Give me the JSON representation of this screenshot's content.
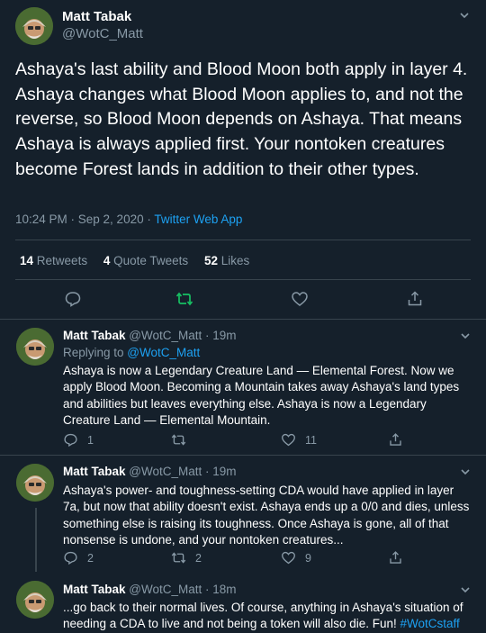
{
  "main": {
    "author": {
      "name": "Matt Tabak",
      "handle": "@WotC_Matt"
    },
    "text": "Ashaya's last ability and Blood Moon both apply in layer 4. Ashaya changes what Blood Moon applies to, and not the reverse, so Blood Moon depends on Ashaya. That means Ashaya is always applied first. Your nontoken creatures become Forest lands in addition to their other types.",
    "time": "10:24 PM · Sep 2, 2020 · ",
    "source": "Twitter Web App",
    "stats": {
      "retweets_count": "14",
      "retweets_label": "Retweets",
      "quotes_count": "4",
      "quotes_label": "Quote Tweets",
      "likes_count": "52",
      "likes_label": "Likes"
    },
    "icons": [
      "reply-icon",
      "retweet-icon",
      "like-icon",
      "share-icon"
    ],
    "retweet_color": "#17bf63"
  },
  "replies": [
    {
      "name": "Matt Tabak",
      "handle": "@WotC_Matt",
      "age": " · 19m",
      "replying_label": "Replying to ",
      "replying_to": "@WotC_Matt",
      "text": "Ashaya is now a Legendary Creature Land — Elemental Forest. Now we apply Blood Moon. Becoming a Mountain takes away Ashaya's land types and abilities but leaves everything else. Ashaya is now a Legendary Creature Land — Elemental Mountain.",
      "reply_count": "1",
      "retweet_count": "",
      "like_count": "11"
    },
    {
      "name": "Matt Tabak",
      "handle": "@WotC_Matt",
      "age": " · 19m",
      "text": "Ashaya's power- and toughness-setting CDA would have applied in layer 7a, but now that ability doesn't exist. Ashaya ends up a 0/0 and dies, unless something else is raising its toughness. Once Ashaya is gone, all of that nonsense is undone, and your nontoken creatures...",
      "reply_count": "2",
      "retweet_count": "2",
      "like_count": "9"
    },
    {
      "name": "Matt Tabak",
      "handle": "@WotC_Matt",
      "age": " · 18m",
      "text": "...go back to their normal lives. Of course, anything in Ashaya's situation of needing a CDA to live and not being a token will also die. Fun! ",
      "hashtag": "#WotCstaff"
    }
  ],
  "colors": {
    "background": "#15202b",
    "secondary_text": "#8899a6",
    "link": "#1da1f2",
    "divider": "#38444d"
  }
}
